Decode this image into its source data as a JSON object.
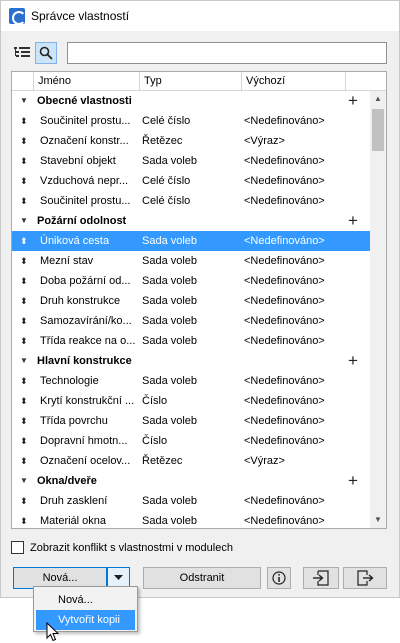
{
  "window": {
    "title": "Správce vlastností"
  },
  "search": {
    "value": "",
    "placeholder": ""
  },
  "table": {
    "headers": [
      "Jméno",
      "Typ",
      "Výchozí"
    ],
    "groups": [
      {
        "name": "Obecné vlastnosti",
        "rows": [
          {
            "name": "Součinitel prostu...",
            "type": "Celé číslo",
            "default": "<Nedefinováno>"
          },
          {
            "name": "Označení konstr...",
            "type": "Řetězec",
            "default": "<Výraz>"
          },
          {
            "name": "Stavební objekt",
            "type": "Sada voleb",
            "default": "<Nedefinováno>"
          },
          {
            "name": "Vzduchová nepr...",
            "type": "Celé číslo",
            "default": "<Nedefinováno>"
          },
          {
            "name": "Součinitel prostu...",
            "type": "Celé číslo",
            "default": "<Nedefinováno>"
          }
        ]
      },
      {
        "name": "Požární odolnost",
        "rows": [
          {
            "name": "Úniková cesta",
            "type": "Sada voleb",
            "default": "<Nedefinováno>",
            "selected": true
          },
          {
            "name": "Mezní stav",
            "type": "Sada voleb",
            "default": "<Nedefinováno>"
          },
          {
            "name": "Doba požární od...",
            "type": "Sada voleb",
            "default": "<Nedefinováno>"
          },
          {
            "name": "Druh konstrukce",
            "type": "Sada voleb",
            "default": "<Nedefinováno>"
          },
          {
            "name": "Samozavírání/ko...",
            "type": "Sada voleb",
            "default": "<Nedefinováno>"
          },
          {
            "name": "Třída reakce na o...",
            "type": "Sada voleb",
            "default": "<Nedefinováno>"
          }
        ]
      },
      {
        "name": "Hlavní konstrukce",
        "rows": [
          {
            "name": "Technologie",
            "type": "Sada voleb",
            "default": "<Nedefinováno>"
          },
          {
            "name": "Krytí konstrukční ...",
            "type": "Číslo",
            "default": "<Nedefinováno>"
          },
          {
            "name": "Třída povrchu",
            "type": "Sada voleb",
            "default": "<Nedefinováno>"
          },
          {
            "name": "Dopravní hmotn...",
            "type": "Číslo",
            "default": "<Nedefinováno>"
          },
          {
            "name": "Označení ocelov...",
            "type": "Řetězec",
            "default": "<Výraz>"
          }
        ]
      },
      {
        "name": "Okna/dveře",
        "rows": [
          {
            "name": "Druh zasklení",
            "type": "Sada voleb",
            "default": "<Nedefinováno>"
          },
          {
            "name": "Materiál okna",
            "type": "Sada voleb",
            "default": "<Nedefinováno>"
          }
        ]
      }
    ]
  },
  "footer": {
    "conflict_label": "Zobrazit konflikt s vlastnostmi v modulech",
    "conflict_checked": false,
    "new_label": "Nová...",
    "remove_label": "Odstranit"
  },
  "dropdown": {
    "items": [
      {
        "label": "Nová...",
        "highlighted": false
      },
      {
        "label": "Vytvořit kopii",
        "highlighted": true
      }
    ]
  },
  "colors": {
    "selection": "#3399ff",
    "accent": "#0078d7"
  },
  "icons": [
    "app-icon",
    "tree-view-icon",
    "search-icon",
    "sort-icon",
    "expand-triangle-icon",
    "add-icon",
    "info-icon",
    "import-icon",
    "export-icon",
    "mouse-cursor-icon"
  ]
}
